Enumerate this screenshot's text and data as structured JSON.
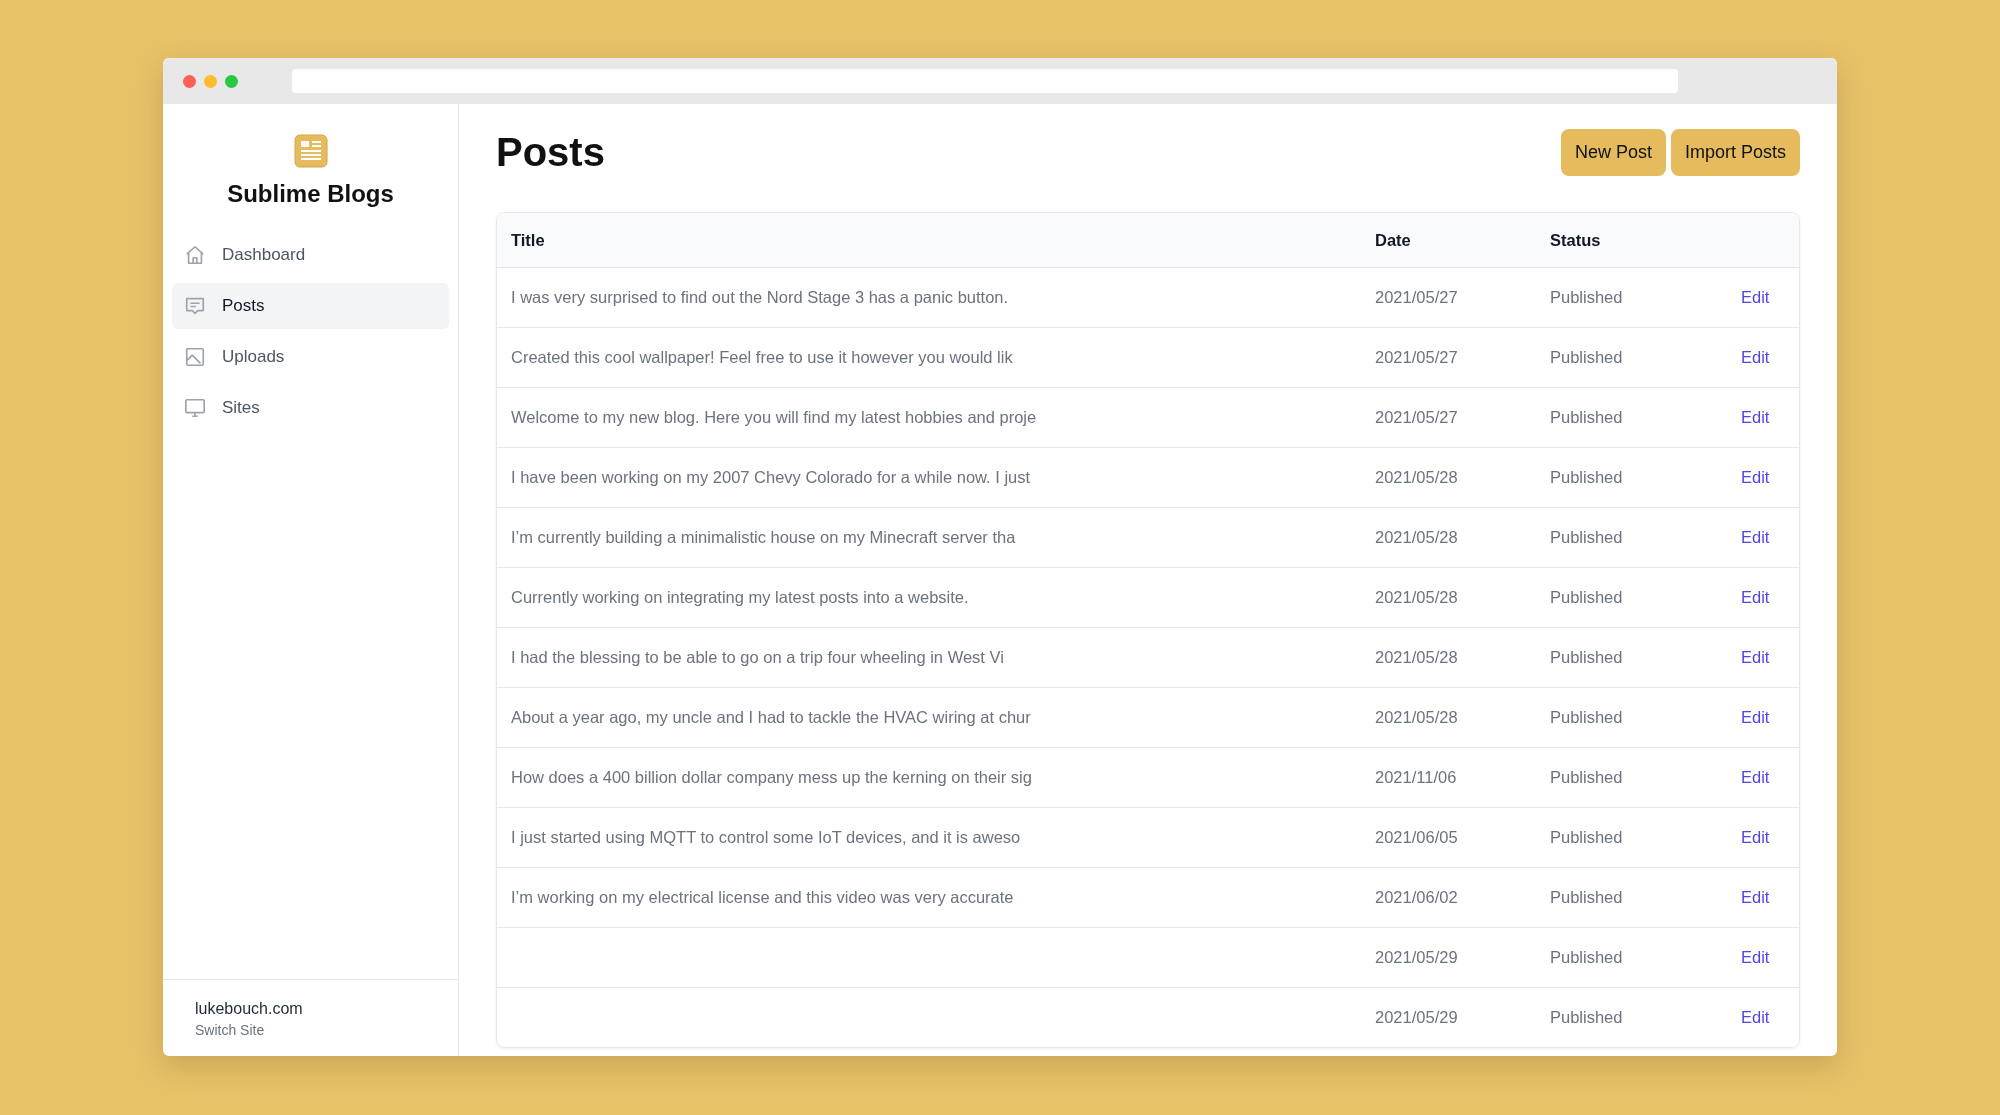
{
  "sidebar": {
    "brand": "Sublime Blogs",
    "items": [
      {
        "label": "Dashboard",
        "selected": false
      },
      {
        "label": "Posts",
        "selected": true
      },
      {
        "label": "Uploads",
        "selected": false
      },
      {
        "label": "Sites",
        "selected": false
      }
    ],
    "site": {
      "name": "lukebouch.com",
      "action": "Switch Site"
    }
  },
  "header": {
    "title": "Posts",
    "buttons": [
      "New Post",
      "Import Posts"
    ]
  },
  "table": {
    "columns": [
      "Title",
      "Date",
      "Status"
    ],
    "rows": [
      {
        "title": "I was very surprised to find out the Nord Stage 3 has a panic button.",
        "date": "2021/05/27",
        "status": "Published",
        "action": "Edit"
      },
      {
        "title": "Created this cool wallpaper! Feel free to use it however you would lik",
        "date": "2021/05/27",
        "status": "Published",
        "action": "Edit"
      },
      {
        "title": "Welcome to my new blog. Here you will find my latest hobbies and proje",
        "date": "2021/05/27",
        "status": "Published",
        "action": "Edit"
      },
      {
        "title": "I have been working on my 2007 Chevy Colorado for a while now. I just",
        "date": "2021/05/28",
        "status": "Published",
        "action": "Edit"
      },
      {
        "title": "I’m currently building a minimalistic house on my Minecraft server tha",
        "date": "2021/05/28",
        "status": "Published",
        "action": "Edit"
      },
      {
        "title": "Currently working on integrating my latest posts into a website.",
        "date": "2021/05/28",
        "status": "Published",
        "action": "Edit"
      },
      {
        "title": "I had the blessing to be able to go on a trip four wheeling in West Vi",
        "date": "2021/05/28",
        "status": "Published",
        "action": "Edit"
      },
      {
        "title": "About a year ago, my uncle and I had to tackle the HVAC wiring at chur",
        "date": "2021/05/28",
        "status": "Published",
        "action": "Edit"
      },
      {
        "title": "How does a 400 billion dollar company mess up the kerning on their sig",
        "date": "2021/11/06",
        "status": "Published",
        "action": "Edit"
      },
      {
        "title": "I just started using MQTT to control some IoT devices, and it is aweso",
        "date": "2021/06/05",
        "status": "Published",
        "action": "Edit"
      },
      {
        "title": "I’m working on my electrical license and this video was very accurate",
        "date": "2021/06/02",
        "status": "Published",
        "action": "Edit"
      },
      {
        "date": "2021/05/29",
        "status": "Published",
        "action": "Edit"
      },
      {
        "date": "2021/05/29",
        "status": "Published",
        "action": "Edit"
      }
    ]
  }
}
